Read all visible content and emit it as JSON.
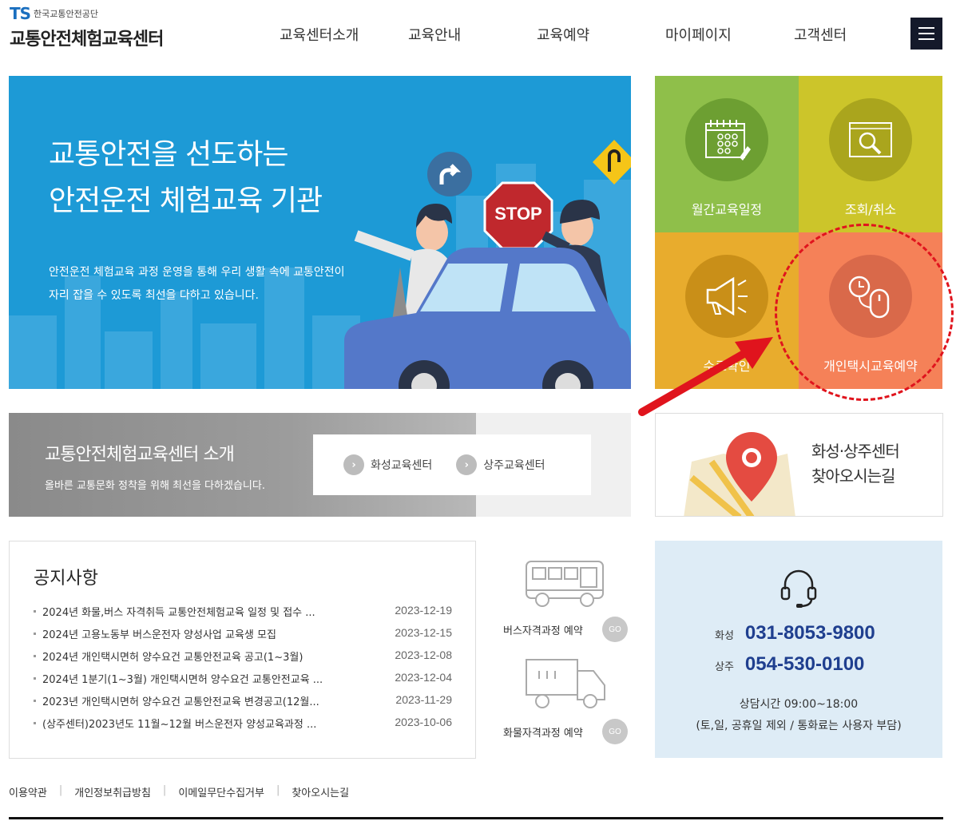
{
  "header": {
    "logo_mark": "TS",
    "org_name": "한국교통안전공단",
    "site_name": "교통안전체험교육센터",
    "nav": [
      "교육센터소개",
      "교육안내",
      "교육예약",
      "마이페이지",
      "고객센터"
    ],
    "menu_icon": "hamburger-icon"
  },
  "hero": {
    "title_line1": "교통안전을 선도하는",
    "title_line2": "안전운전 체험교육 기관",
    "desc_line1": "안전운전 체험교육 과정 운영을 통해 우리 생활 속에 교통안전이",
    "desc_line2": "자리 잡을 수 있도록 최선을 다하고 있습니다.",
    "stop_sign": "STOP",
    "bg_color": "#1d9ad6"
  },
  "quick": {
    "items": [
      {
        "label": "월간교육일정",
        "icon": "calendar-icon",
        "color": "#8fbf4a"
      },
      {
        "label": "조회/취소",
        "icon": "search-window-icon",
        "color": "#ccc52a"
      },
      {
        "label": "수료확인",
        "icon": "megaphone-icon",
        "color": "#e8ac2d"
      },
      {
        "label": "개인택시교육예약",
        "icon": "clock-mouse-icon",
        "color": "#f58158"
      }
    ]
  },
  "intro": {
    "title": "교통안전체험교육센터 소개",
    "subtitle": "올바른 교통문화 정착을 위해 최선을 다하겠습니다.",
    "links": [
      "화성교육센터",
      "상주교육센터"
    ]
  },
  "directions": {
    "line1": "화성·상주센터",
    "line2": "찾아오시는길"
  },
  "notice": {
    "title": "공지사항",
    "items": [
      {
        "title": "2024년 화물,버스 자격취득 교통안전체험교육 일정 및 접수 ...",
        "date": "2023-12-19"
      },
      {
        "title": "2024년 고용노동부 버스운전자 양성사업 교육생 모집",
        "date": "2023-12-15"
      },
      {
        "title": "2024년 개인택시면허 양수요건 교통안전교육 공고(1~3월)",
        "date": "2023-12-08"
      },
      {
        "title": "2024년 1분기(1~3월) 개인택시면허 양수요건 교통안전교육 ...",
        "date": "2023-12-04"
      },
      {
        "title": "2023년 개인택시면허 양수요건 교통안전교육 변경공고(12월...",
        "date": "2023-11-29"
      },
      {
        "title": "(상주센터)2023년도 11월~12월 버스운전자 양성교육과정 ...",
        "date": "2023-10-06"
      }
    ]
  },
  "courses": {
    "bus_label": "버스자격과정 예약",
    "truck_label": "화물자격과정 예약",
    "go": "GO"
  },
  "contact": {
    "hwaseong_label": "화성",
    "hwaseong_phone": "031-8053-9800",
    "sangju_label": "상주",
    "sangju_phone": "054-530-0100",
    "hours": "상담시간 09:00~18:00",
    "note": "(토,일, 공휴일 제외 / 통화료는 사용자 부담)"
  },
  "footer": {
    "links": [
      "이용약관",
      "개인정보취급방침",
      "이메일무단수집거부",
      "찾아오시는길"
    ]
  }
}
